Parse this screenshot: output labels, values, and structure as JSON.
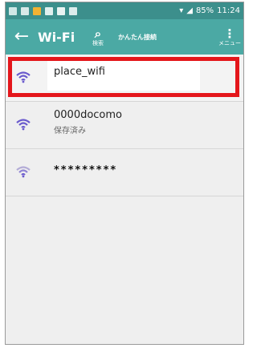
{
  "status_bar": {
    "time": "11:24",
    "battery": "85%",
    "bg_color": "#3c8f8c"
  },
  "app_bar": {
    "back_icon": "arrow-left",
    "title": "Wi-Fi",
    "search_label": "検索",
    "easy_connect_label": "かんたん接続",
    "menu_label": "メニュー",
    "bg_color": "#4ba9a4"
  },
  "networks": [
    {
      "ssid": "place_wifi",
      "selected": true
    },
    {
      "ssid": "0000docomo",
      "status": "保存済み"
    },
    {
      "ssid": "*********"
    }
  ],
  "highlight_color": "#e4161b"
}
